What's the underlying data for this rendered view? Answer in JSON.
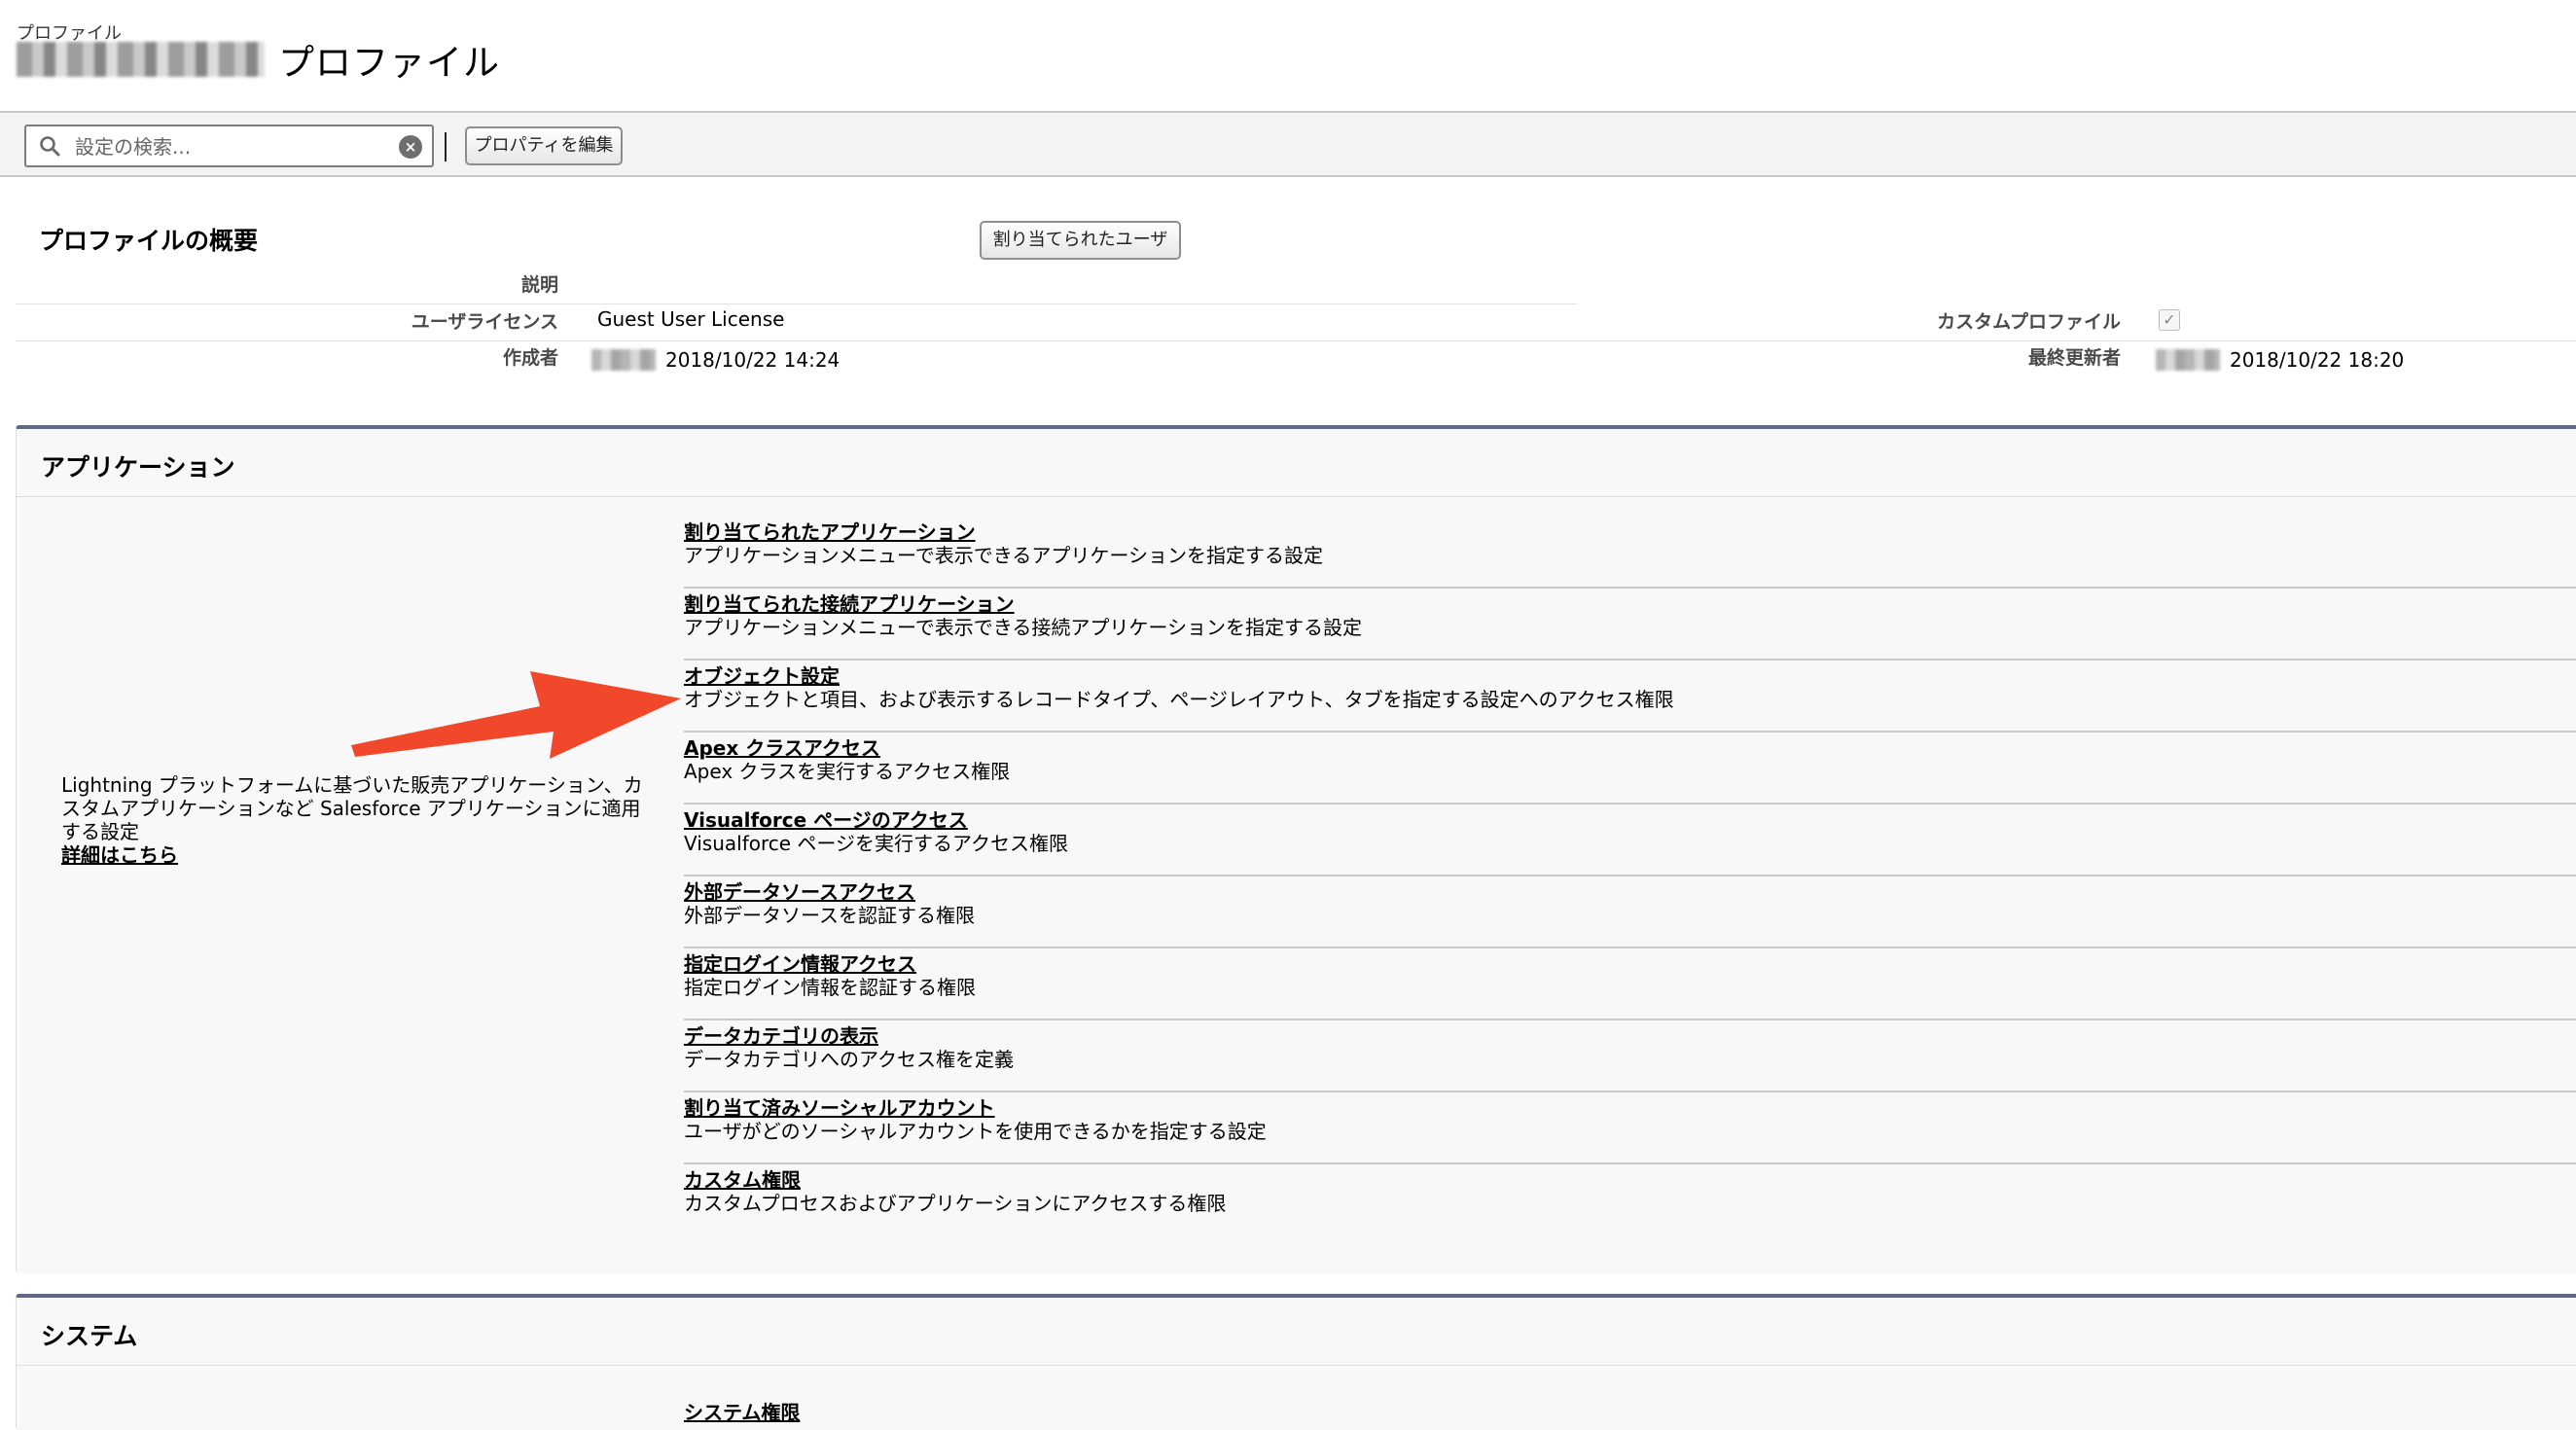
{
  "header": {
    "breadcrumb": "プロファイル",
    "title": "プロファイル"
  },
  "toolbar": {
    "search_placeholder": "設定の検索...",
    "edit_properties_label": "プロパティを編集"
  },
  "overview": {
    "title": "プロファイルの概要",
    "assigned_users_label": "割り当てられたユーザ",
    "description_label": "説明",
    "description_value": "",
    "user_license_label": "ユーザライセンス",
    "user_license_value": "Guest User License",
    "custom_profile_label": "カスタムプロファイル",
    "custom_profile_checked": true,
    "created_by_label": "作成者",
    "created_date": "2018/10/22 14:24",
    "last_modified_label": "最終更新者",
    "last_modified_date": "2018/10/22 18:20"
  },
  "apps_section": {
    "title": "アプリケーション",
    "description": "Lightning プラットフォームに基づいた販売アプリケーション、カスタムアプリケーションなど Salesforce アプリケーションに適用する設定",
    "details_link": "詳細はこちら",
    "items": [
      {
        "title": "割り当てられたアプリケーション",
        "desc": "アプリケーションメニューで表示できるアプリケーションを指定する設定"
      },
      {
        "title": "割り当てられた接続アプリケーション",
        "desc": "アプリケーションメニューで表示できる接続アプリケーションを指定する設定"
      },
      {
        "title": "オブジェクト設定",
        "desc": "オブジェクトと項目、および表示するレコードタイプ、ページレイアウト、タブを指定する設定へのアクセス権限"
      },
      {
        "title": "Apex クラスアクセス",
        "desc": "Apex クラスを実行するアクセス権限"
      },
      {
        "title": "Visualforce ページのアクセス",
        "desc": "Visualforce ページを実行するアクセス権限"
      },
      {
        "title": "外部データソースアクセス",
        "desc": "外部データソースを認証する権限"
      },
      {
        "title": "指定ログイン情報アクセス",
        "desc": "指定ログイン情報を認証する権限"
      },
      {
        "title": "データカテゴリの表示",
        "desc": "データカテゴリへのアクセス権を定義"
      },
      {
        "title": "割り当て済みソーシャルアカウント",
        "desc": "ユーザがどのソーシャルアカウントを使用できるかを指定する設定"
      },
      {
        "title": "カスタム権限",
        "desc": "カスタムプロセスおよびアプリケーションにアクセスする権限"
      }
    ]
  },
  "system_section": {
    "title": "システム",
    "items": [
      {
        "title": "システム権限"
      }
    ]
  },
  "colors": {
    "section_accent": "#5d6986",
    "annotation_arrow": "#f1472b"
  },
  "icons": {
    "search": "search-icon",
    "clear": "clear-icon",
    "checkbox": "checkmark-icon",
    "arrow": "arrow-annotation"
  }
}
